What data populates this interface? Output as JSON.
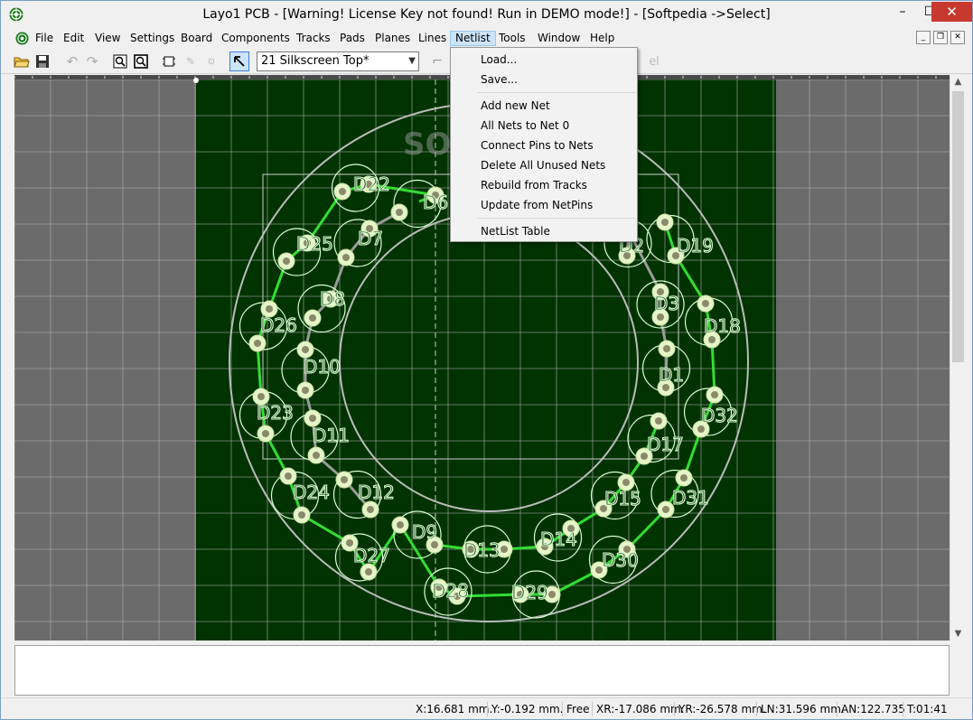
{
  "window": {
    "title": "Layo1 PCB - [Warning! License Key not found! Run in DEMO mode!] - [Softpedia ->Select]",
    "min_label": "–",
    "max_label": "☐",
    "close_label": "✕"
  },
  "menu": {
    "items": [
      "File",
      "Edit",
      "View",
      "Settings",
      "Board",
      "Components",
      "Tracks",
      "Pads",
      "Planes",
      "Lines",
      "Netlist",
      "Tools",
      "Window",
      "Help"
    ],
    "active": "Netlist"
  },
  "toolbar": {
    "layer_value": "21 Silkscreen Top*",
    "faded_label": "el"
  },
  "netlist_menu": {
    "items": [
      "Load...",
      "Save...",
      "Add new Net",
      "All Nets to Net 0",
      "Connect Pins to Nets",
      "Delete All Unused Nets",
      "Rebuild from Tracks",
      "Update from NetPins",
      "NetList Table"
    ]
  },
  "pcb": {
    "labels": [
      "D22",
      "D6",
      "D25",
      "D7",
      "D8",
      "D26",
      "D10",
      "D23",
      "D11",
      "D24",
      "D12",
      "D27",
      "D9",
      "D13",
      "D14",
      "D30",
      "D28",
      "D29",
      "D15",
      "D31",
      "D17",
      "D32",
      "D1",
      "D18",
      "D3",
      "D19",
      "D2"
    ],
    "watermark": "SOFTPEDIA"
  },
  "status": {
    "x": "X:16.681 mm.",
    "y": "Y:-0.192 mm.",
    "mode": "Free",
    "xr": "XR:-17.086 mm.",
    "yr": "YR:-26.578 mm.",
    "ln": "LN:31.596 mm.",
    "an": "AN:122.735",
    "t": "T:01:41"
  },
  "colors": {
    "board": "#003300",
    "outside": "#6b6b6b",
    "track": "#33dd33",
    "silkscreen": "#d8ffd0"
  }
}
